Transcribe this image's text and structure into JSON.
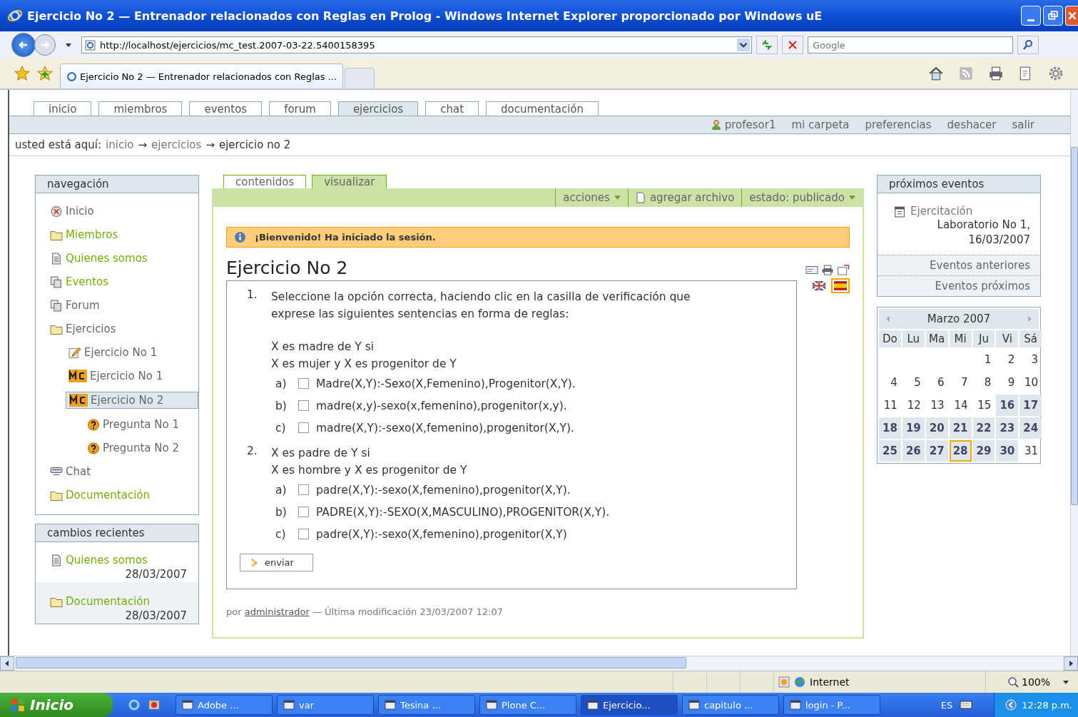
{
  "window": {
    "title": "Ejercicio No 2 — Entrenador relacionados con Reglas en Prolog - Windows Internet Explorer proporcionado por Windows uE"
  },
  "address_bar": {
    "url": "http://localhost/ejercicios/mc_test.2007-03-22.5400158395",
    "search_placeholder": "Google"
  },
  "browser_tabs": [
    {
      "label": "Ejercicio No 2 — Entrenador relacionados con Reglas ...",
      "selected": true
    }
  ],
  "site_tabs": [
    {
      "label": "inicio",
      "selected": false
    },
    {
      "label": "miembros",
      "selected": false
    },
    {
      "label": "eventos",
      "selected": false
    },
    {
      "label": "forum",
      "selected": false
    },
    {
      "label": "ejercicios",
      "selected": true
    },
    {
      "label": "chat",
      "selected": false
    },
    {
      "label": "documentación",
      "selected": false
    }
  ],
  "user_actions": [
    "profesor1",
    "mi carpeta",
    "preferencias",
    "deshacer",
    "salir"
  ],
  "breadcrumbs": {
    "label": "usted está aquí:",
    "items": [
      {
        "label": "inicio"
      },
      {
        "separator": "→",
        "label": "ejercicios"
      },
      {
        "separator": "→",
        "label": "ejercicio no 2"
      }
    ]
  },
  "navigation": {
    "title": "navegación",
    "items": [
      {
        "label": "Inicio",
        "kind": "home",
        "published": false,
        "selected": false
      },
      {
        "label": "Miembros",
        "kind": "folder",
        "published": true,
        "selected": false
      },
      {
        "label": "Quienes somos",
        "kind": "page",
        "published": true,
        "selected": false
      },
      {
        "label": "Eventos",
        "kind": "stack",
        "published": true,
        "selected": false
      },
      {
        "label": "Forum",
        "kind": "stack",
        "published": false,
        "selected": false
      },
      {
        "label": "Ejercicios",
        "kind": "folder",
        "published": false,
        "selected": false,
        "children": [
          {
            "label": "Ejercicio No 1",
            "kind": "pencil",
            "published": false,
            "selected": false
          },
          {
            "label": "Ejercicio No 1",
            "kind": "mc",
            "published": false,
            "selected": false
          },
          {
            "label": "Ejercicio No 2",
            "kind": "mc",
            "published": false,
            "selected": true,
            "children": [
              {
                "label": "Pregunta No 1",
                "kind": "question",
                "published": false,
                "selected": false
              },
              {
                "label": "Pregunta No 2",
                "kind": "question",
                "published": false,
                "selected": false
              }
            ]
          }
        ]
      },
      {
        "label": "Chat",
        "kind": "chat",
        "published": false,
        "selected": false
      },
      {
        "label": "Documentación",
        "kind": "folder",
        "published": true,
        "selected": false
      }
    ]
  },
  "recent_changes": {
    "title": "cambios recientes",
    "items": [
      {
        "label": "Quienes somos",
        "kind": "page",
        "date": "28/03/2007"
      },
      {
        "label": "Documentación",
        "kind": "folder",
        "date": "28/03/2007"
      }
    ]
  },
  "content_tabs": [
    {
      "label": "contenidos",
      "selected": false
    },
    {
      "label": "visualizar",
      "selected": true
    }
  ],
  "content_actions": [
    {
      "label": "acciones",
      "kind": "menu"
    },
    {
      "label": "agregar archivo",
      "kind": "add"
    },
    {
      "label": "estado: publicado",
      "kind": "menu"
    }
  ],
  "status_message": "¡Bienvenido! Ha iniciado la sesión.",
  "heading": "Ejercicio No 2",
  "questions": [
    {
      "number": "1.",
      "lines": [
        "Seleccione la opción correcta, haciendo clic en la casilla de verificación que exprese las siguientes sentencias en forma de reglas:",
        "X es madre de Y si",
        "X es mujer y X es progenitor de Y"
      ],
      "options": [
        {
          "letter": "a)",
          "text": "Madre(X,Y):-Sexo(X,Femenino),Progenitor(X,Y).",
          "checked": false
        },
        {
          "letter": "b)",
          "text": "madre(x,y)-sexo(x,femenino),progenitor(x,y).",
          "checked": false
        },
        {
          "letter": "c)",
          "text": "madre(X,Y):-sexo(X,femenino),progenitor(X,Y).",
          "checked": false
        }
      ]
    },
    {
      "number": "2.",
      "lines": [
        "X es padre de Y si",
        "X es hombre y X es progenitor de Y"
      ],
      "options": [
        {
          "letter": "a)",
          "text": "padre(X,Y):-sexo(X,femenino),progenitor(X,Y).",
          "checked": false
        },
        {
          "letter": "b)",
          "text": "PADRE(X,Y):-SEXO(X,MASCULINO),PROGENITOR(X,Y).",
          "checked": false
        },
        {
          "letter": "c)",
          "text": "padre(X,Y):-sexo(X,femenino),progenitor(X,Y)",
          "checked": false
        }
      ]
    }
  ],
  "submit_button": "enviar",
  "byline": {
    "prefix": "por",
    "author": "administrador",
    "modified": "— Última modificación 23/03/2007 12:07"
  },
  "languages": [
    {
      "kind": "english",
      "selected": false
    },
    {
      "kind": "spanish",
      "selected": true
    }
  ],
  "upcoming_events": {
    "title": "próximos eventos",
    "events": [
      {
        "title": "Ejercitación",
        "detail": "Laboratorio No 1,",
        "date": "16/03/2007"
      }
    ],
    "links": [
      "Eventos anteriores",
      "Eventos próximos"
    ]
  },
  "calendar": {
    "month": "Marzo 2007",
    "weekdays": [
      "Do",
      "Lu",
      "Ma",
      "Mi",
      "Ju",
      "Vi",
      "Sá"
    ],
    "weeks": [
      [
        {
          "day": "1",
          "event": false,
          "today": false
        },
        {
          "day": "2",
          "event": false,
          "today": false
        },
        {
          "day": "3",
          "event": false,
          "today": false
        }
      ],
      [
        {
          "day": "4",
          "event": false,
          "today": false
        },
        {
          "day": "5",
          "event": false,
          "today": false
        },
        {
          "day": "6",
          "event": false,
          "today": false
        },
        {
          "day": "7",
          "event": false,
          "today": false
        },
        {
          "day": "8",
          "event": false,
          "today": false
        },
        {
          "day": "9",
          "event": false,
          "today": false
        },
        {
          "day": "10",
          "event": false,
          "today": false
        }
      ],
      [
        {
          "day": "11",
          "event": false,
          "today": false
        },
        {
          "day": "12",
          "event": false,
          "today": false
        },
        {
          "day": "13",
          "event": false,
          "today": false
        },
        {
          "day": "14",
          "event": false,
          "today": false
        },
        {
          "day": "15",
          "event": false,
          "today": false
        },
        {
          "day": "16",
          "event": true,
          "today": false
        },
        {
          "day": "17",
          "event": true,
          "today": false
        }
      ],
      [
        {
          "day": "18",
          "event": true,
          "today": false
        },
        {
          "day": "19",
          "event": true,
          "today": false
        },
        {
          "day": "20",
          "event": true,
          "today": false
        },
        {
          "day": "21",
          "event": true,
          "today": false
        },
        {
          "day": "22",
          "event": true,
          "today": false
        },
        {
          "day": "23",
          "event": true,
          "today": false
        },
        {
          "day": "24",
          "event": true,
          "today": false
        }
      ],
      [
        {
          "day": "25",
          "event": true,
          "today": false
        },
        {
          "day": "26",
          "event": true,
          "today": false
        },
        {
          "day": "27",
          "event": true,
          "today": false
        },
        {
          "day": "28",
          "event": true,
          "today": true
        },
        {
          "day": "29",
          "event": true,
          "today": false
        },
        {
          "day": "30",
          "event": true,
          "today": false
        },
        {
          "day": "31",
          "event": false,
          "today": false
        }
      ]
    ]
  },
  "status_bar": {
    "zone": "Internet",
    "zoom": "100%"
  },
  "taskbar": {
    "start": "Inicio",
    "tasks": [
      {
        "label": "Adobe ...",
        "selected": false
      },
      {
        "label": "var",
        "selected": false
      },
      {
        "label": "Tesina ...",
        "selected": false
      },
      {
        "label": "Plone C...",
        "selected": false
      },
      {
        "label": "Ejercicio...",
        "selected": true
      },
      {
        "label": "capitulo ...",
        "selected": false
      },
      {
        "label": "login - P...",
        "selected": false
      }
    ],
    "language": "ES",
    "clock": "12:28 p.m."
  }
}
